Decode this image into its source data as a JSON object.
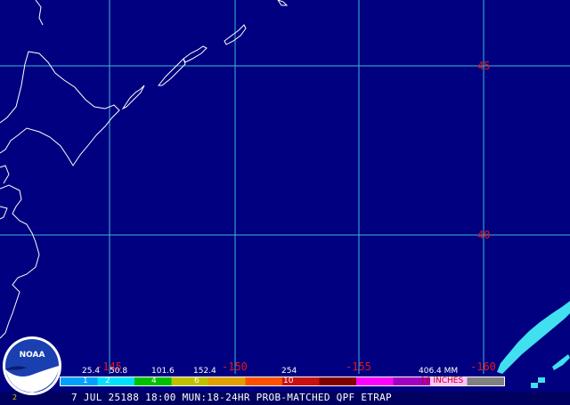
{
  "map": {
    "background_color": "#000080",
    "grid_color": "#3fb8d8",
    "coast_color": "#ffffff",
    "label_color": "#e01818",
    "precip_color": "#40e0f0"
  },
  "labels": {
    "lat_45": "45",
    "lat_40": "40",
    "lon_145": "-145",
    "lon_150": "-150",
    "lon_155": "-155",
    "lon_160": "-160"
  },
  "legend": {
    "mm_values": [
      "25.4",
      "50.8",
      "101.6",
      "152.4",
      "254",
      "406.4 MM"
    ],
    "inch_labels": [
      "1",
      "2",
      "4",
      "6",
      "10",
      "16 INCHES"
    ],
    "colors": [
      "#00a0ff",
      "#00e0ff",
      "#00c000",
      "#c0c000",
      "#e0a000",
      "#ff5000",
      "#c81010",
      "#800000",
      "#ff00ff",
      "#a000c0",
      "#ffc0ff",
      "#808080"
    ]
  },
  "caption": "7 JUL 25188 18:00 MUN:18-24HR PROB-MATCHED QPF ETRAP",
  "logo": {
    "text": "NOAA"
  },
  "corner_mark": "2"
}
